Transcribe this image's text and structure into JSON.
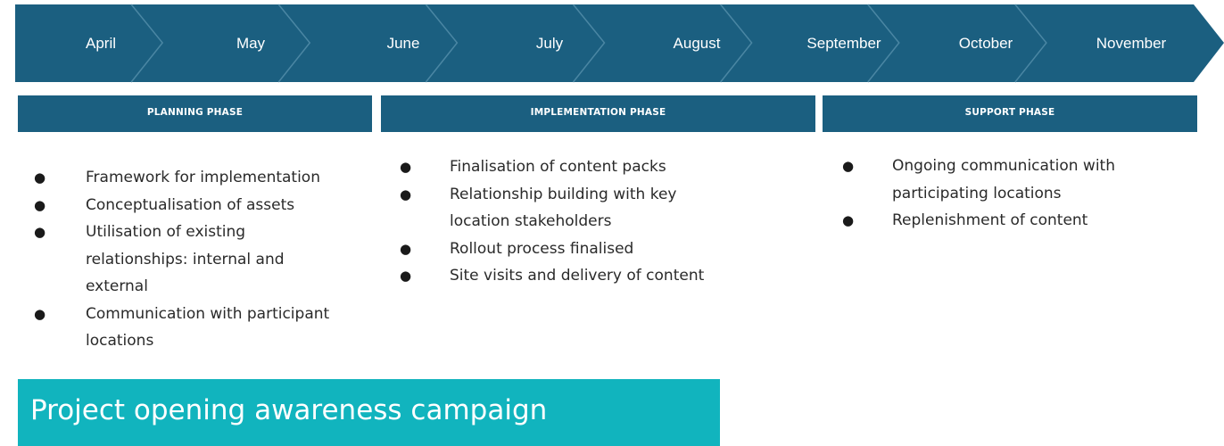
{
  "timeline": {
    "months": [
      "April",
      "May",
      "June",
      "July",
      "August",
      "September",
      "October",
      "November"
    ],
    "bar_color": "#1b5f80",
    "chevron_color": "#4a86a3"
  },
  "phases": [
    {
      "title": "PLANNING PHASE",
      "items": [
        "Framework for implementation",
        "Conceptualisation of assets",
        "Utilisation of existing relationships: internal and external",
        "Communication with participant locations"
      ]
    },
    {
      "title": "IMPLEMENTATION PHASE",
      "items": [
        "Finalisation of content packs",
        "Relationship building with key location stakeholders",
        "Rollout process finalised",
        "Site visits and delivery of content"
      ]
    },
    {
      "title": "SUPPORT PHASE",
      "items": [
        "Ongoing communication with participating locations",
        "Replenishment of content"
      ]
    }
  ],
  "banner": {
    "text": "Project opening awareness campaign",
    "color": "#11b4be"
  }
}
